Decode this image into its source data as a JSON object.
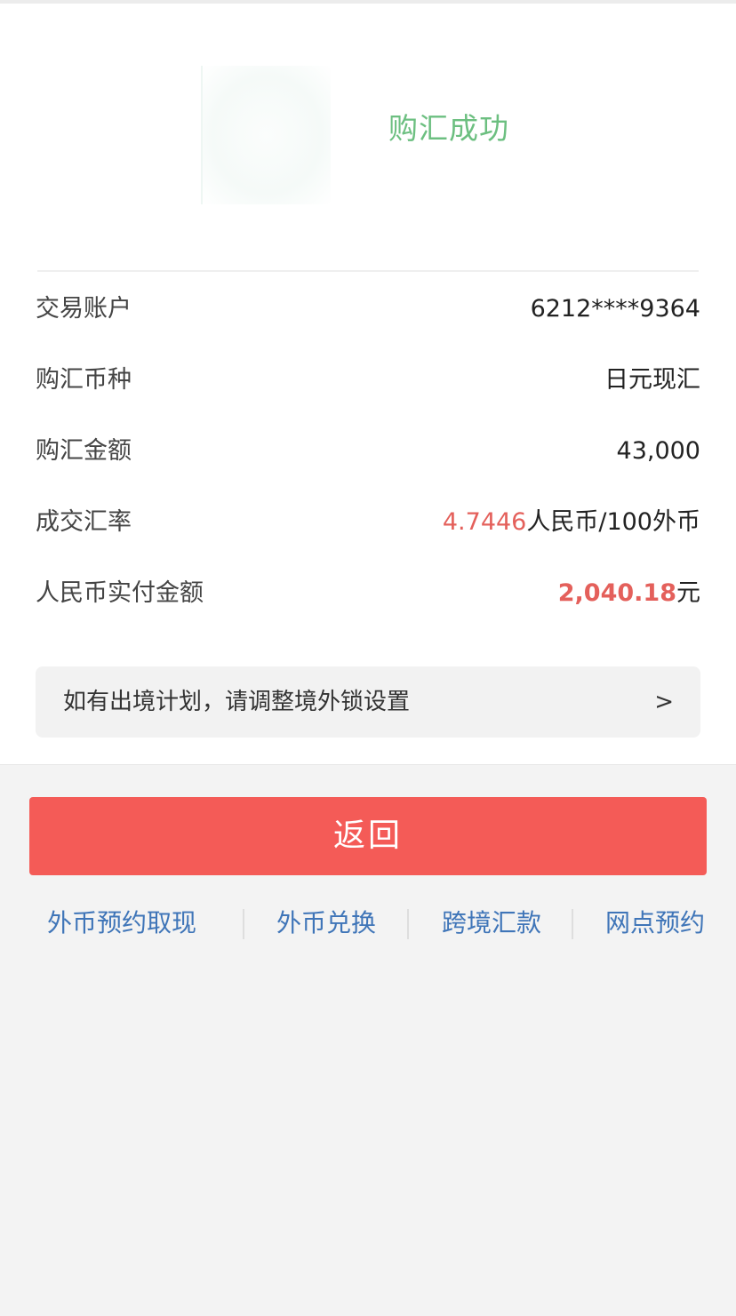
{
  "status": {
    "icon": "success-icon",
    "text": "购汇成功"
  },
  "details": [
    {
      "label": "交易账户",
      "value": "6212****9364"
    },
    {
      "label": "购汇币种",
      "value": "日元现汇"
    },
    {
      "label": "购汇金额",
      "value": "43,000"
    },
    {
      "label": "成交汇率",
      "value_highlight": "4.7446",
      "value_suffix": "人民币/100外币"
    },
    {
      "label": "人民币实付金额",
      "value_highlight": "2,040.18",
      "value_suffix": "元"
    }
  ],
  "notice": {
    "text": "如有出境计划，请调整境外锁设置",
    "arrow": ">"
  },
  "return_button": "返回",
  "quick_links": [
    "外币预约取现",
    "外币兑换",
    "跨境汇款",
    "网点预约"
  ],
  "colors": {
    "success": "#6cbf80",
    "accent_red": "#e4605b",
    "button": "#f45b57",
    "link": "#3f75b8"
  }
}
